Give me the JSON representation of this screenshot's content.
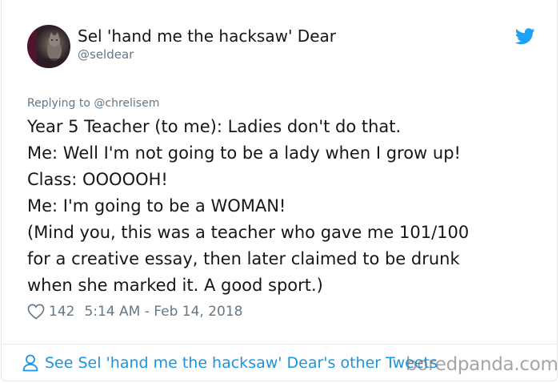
{
  "tweet": {
    "display_name": "Sel 'hand me the hacksaw' Dear",
    "handle": "@seldear",
    "replying_to": "Replying to @chrelisem",
    "lines": [
      "Year 5 Teacher (to me): Ladies don't do that.",
      "Me: Well I'm not going to be a lady when I grow up!",
      "Class: OOOOOH!",
      "Me: I'm going to be a WOMAN!",
      "(Mind you, this was a teacher who gave me 101/100",
      "for a creative essay, then later claimed to be drunk",
      "when she marked it. A good sport.)"
    ],
    "like_count": "142",
    "timestamp": "5:14 AM - Feb 14, 2018"
  },
  "footer": {
    "link_label": "See Sel 'hand me the hacksaw' Dear's other Tweets"
  },
  "watermark": "boredpanda.com",
  "icons": {
    "brand": "twitter-bird-icon",
    "like": "heart-icon",
    "profile": "person-icon"
  },
  "colors": {
    "text": "#14171a",
    "secondary": "#657786",
    "link": "#1b95e0",
    "twitter_blue": "#1da1f2",
    "border": "#e1e8ed"
  }
}
